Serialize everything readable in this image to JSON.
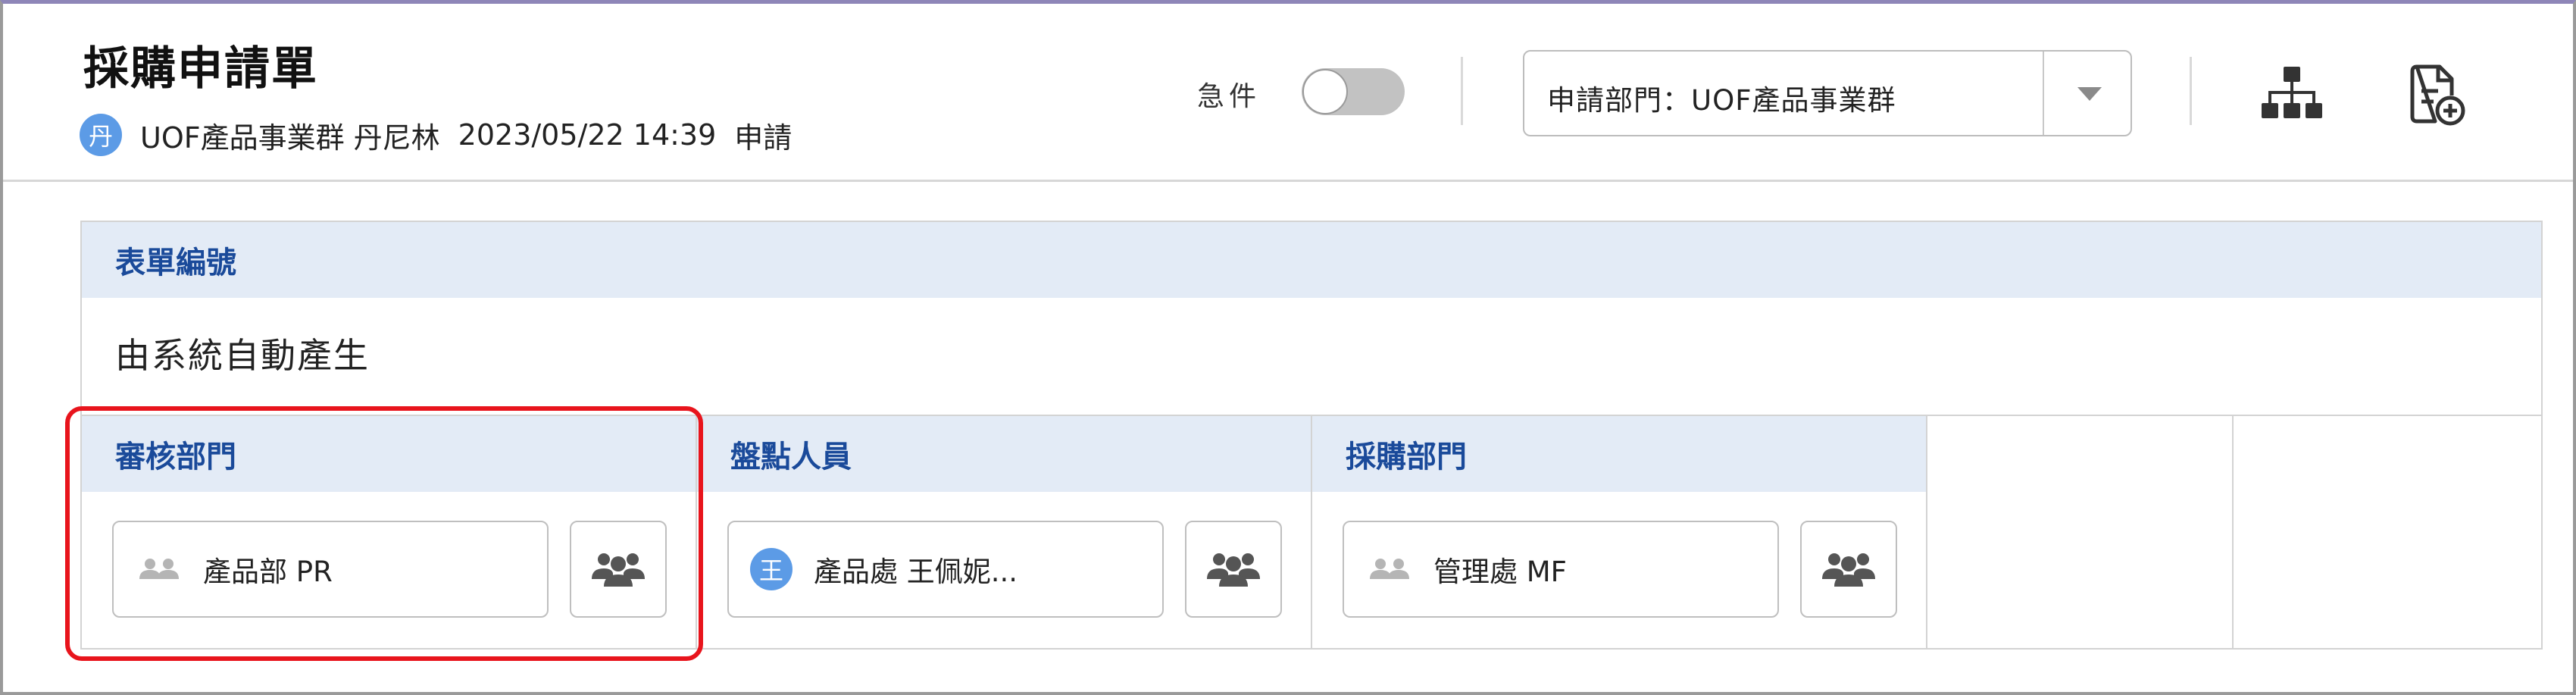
{
  "header": {
    "title": "採購申請單",
    "applicant_avatar": "丹",
    "applicant": "UOF產品事業群 丹尼林",
    "datetime": "2023/05/22 14:39",
    "action": "申請",
    "urgent_label": "急件",
    "urgent_on": false,
    "dept_select_value": "申請部門：UOF產品事業群",
    "tool_icons": [
      "org-chart-icon",
      "add-document-icon"
    ]
  },
  "form": {
    "form_no_label": "表單編號",
    "form_no_value": "由系統自動產生",
    "columns": [
      {
        "label": "審核部門",
        "value": "產品部  PR",
        "icon": "people-icon"
      },
      {
        "label": "盤點人員",
        "value": "產品處 王佩妮...",
        "avatar": "王"
      },
      {
        "label": "採購部門",
        "value": "管理處  MF",
        "icon": "people-icon"
      }
    ],
    "picker_icon": "group-picker-icon"
  },
  "colors": {
    "section_header_bg": "#e3ebf6",
    "section_header_text": "#1a4a9a",
    "avatar_bg": "#5c9be6",
    "highlight": "#e8141c"
  }
}
